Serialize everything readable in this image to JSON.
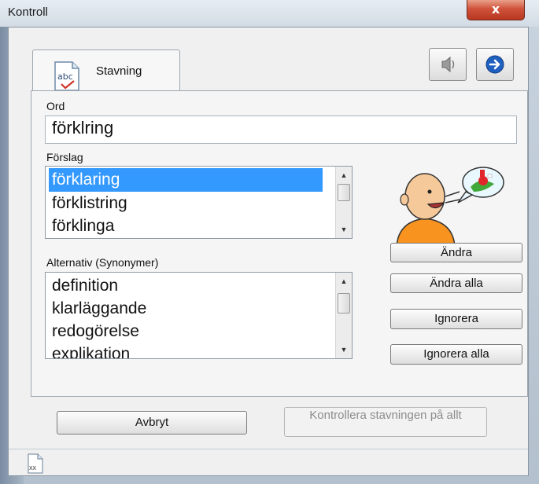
{
  "window": {
    "title": "Kontroll",
    "close_symbol": "x"
  },
  "tabs": [
    {
      "label": "Stavning",
      "icon": "spellcheck-icon"
    }
  ],
  "toolbar": {
    "speak_icon": "speaker-icon",
    "next_icon": "arrow-right-icon"
  },
  "word": {
    "label": "Ord",
    "value": "förklring"
  },
  "suggestions": {
    "label": "Förslag",
    "items": [
      "förklaring",
      "förklistring",
      "förklinga"
    ],
    "selected_index": 0
  },
  "alternatives": {
    "label": "Alternativ (Synonymer)",
    "items": [
      "definition",
      "klarläggande",
      "redogörelse",
      "explikation"
    ]
  },
  "actions": {
    "change": "Ändra",
    "change_all": "Ändra alla",
    "ignore": "Ignorera",
    "ignore_all": "Ignorera alla"
  },
  "footer": {
    "cancel": "Avbryt",
    "check_all": "Kontrollera stavningen på allt"
  },
  "status": {
    "file_icon_text": "xx"
  },
  "colors": {
    "selection": "#3399ff",
    "close_button": "#d0523a"
  }
}
